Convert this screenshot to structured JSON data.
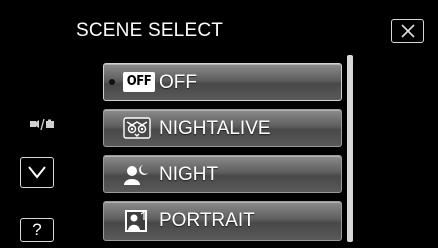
{
  "header": {
    "title": "SCENE SELECT"
  },
  "menu": {
    "items": [
      {
        "label": "OFF",
        "icon": "off-badge-icon",
        "badge": "OFF",
        "selected": true
      },
      {
        "label": "NIGHTALIVE",
        "icon": "owl-icon",
        "selected": false
      },
      {
        "label": "NIGHT",
        "icon": "person-moon-icon",
        "selected": false
      },
      {
        "label": "PORTRAIT",
        "icon": "portrait-icon",
        "selected": false
      }
    ]
  },
  "sidebar": {
    "mode_icon": "video-photo-toggle-icon",
    "down_icon": "chevron-down-icon",
    "help_label": "?"
  },
  "colors": {
    "background": "#000000",
    "item_top": "#8c8c8c",
    "item_bottom": "#484848",
    "text": "#ffffff",
    "scrollbar": "#d8d8d8"
  }
}
